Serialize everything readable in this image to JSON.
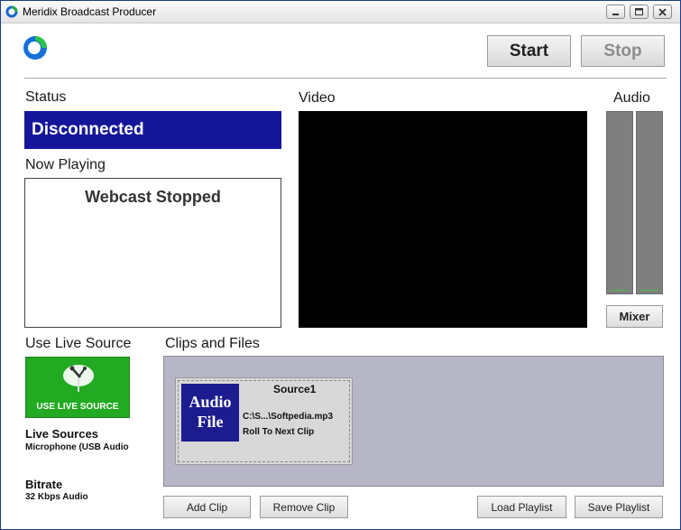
{
  "window": {
    "title": "Meridix Broadcast Producer"
  },
  "toolbar": {
    "start_label": "Start",
    "stop_label": "Stop"
  },
  "status": {
    "heading": "Status",
    "value": "Disconnected"
  },
  "now_playing": {
    "heading": "Now Playing",
    "value": "Webcast Stopped"
  },
  "video": {
    "heading": "Video"
  },
  "audio": {
    "heading": "Audio",
    "mixer_label": "Mixer",
    "left_level": 0.0,
    "right_level": 0.0
  },
  "live_source": {
    "heading": "Use Live Source",
    "button_label": "USE LIVE SOURCE",
    "sources_label": "Live Sources",
    "sources_value": "Microphone (USB Audio",
    "bitrate_label": "Bitrate",
    "bitrate_value": "32 Kbps Audio"
  },
  "clips": {
    "heading": "Clips and Files",
    "items": [
      {
        "title": "Source1",
        "thumb_line1": "Audio",
        "thumb_line2": "File",
        "file": "C:\\S...\\Softpedia.mp3",
        "mode": "Roll To Next Clip"
      }
    ],
    "add_label": "Add Clip",
    "remove_label": "Remove Clip",
    "load_label": "Load Playlist",
    "save_label": "Save Playlist"
  },
  "colors": {
    "status_bg": "#15159a",
    "live_button": "#22aa22",
    "clip_thumb": "#1c1c8f",
    "clips_panel": "#b6b6c6"
  }
}
